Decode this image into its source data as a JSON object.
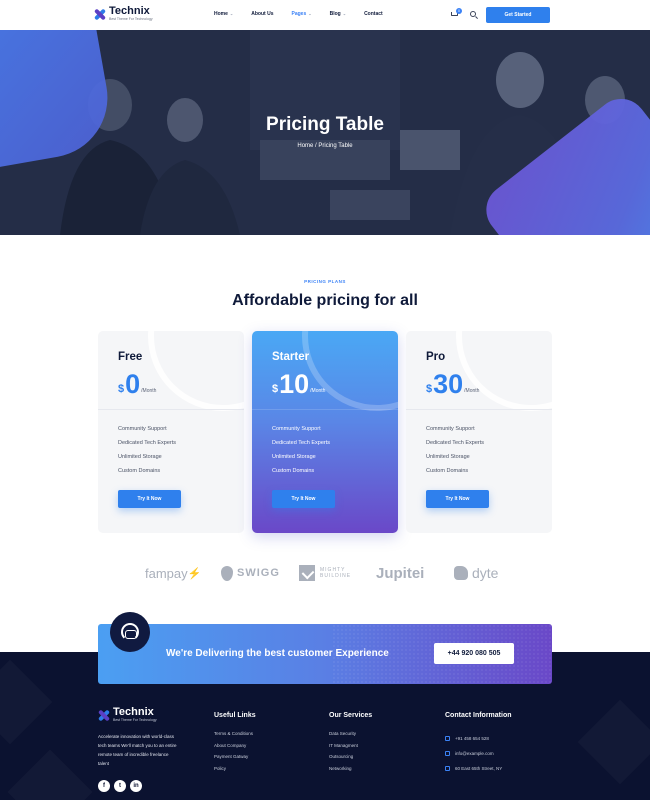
{
  "header": {
    "logo_name": "Technix",
    "logo_tagline": "Best Theme For Technology",
    "nav": [
      {
        "label": "Home",
        "caret": true
      },
      {
        "label": "About Us",
        "caret": false
      },
      {
        "label": "Pages",
        "caret": true
      },
      {
        "label": "Blog",
        "caret": true
      },
      {
        "label": "Contact",
        "caret": false
      }
    ],
    "cart_count": "0",
    "cta_label": "Get Started"
  },
  "hero": {
    "title": "Pricing Table",
    "breadcrumb": "Home / Pricing Table"
  },
  "pricing": {
    "eyebrow": "PRICING PLANS",
    "title": "Affordable pricing for all",
    "plans": [
      {
        "name": "Free",
        "currency": "$",
        "price": "0",
        "period": "/Month",
        "features": [
          "Community Support",
          "Dedicated Tech Experts",
          "Unlimited Storage",
          "Custom Domains"
        ],
        "button": "Try It Now"
      },
      {
        "name": "Starter",
        "currency": "$",
        "price": "10",
        "period": "/Month",
        "features": [
          "Community Support",
          "Dedicated Tech Experts",
          "Unlimited Storage",
          "Custom Domains"
        ],
        "button": "Try It Now"
      },
      {
        "name": "Pro",
        "currency": "$",
        "price": "30",
        "period": "/Month",
        "features": [
          "Community Support",
          "Dedicated Tech Experts",
          "Unlimited Storage",
          "Custom Domains"
        ],
        "button": "Try It Now"
      }
    ]
  },
  "brands": {
    "fampay": "fampay",
    "swiggy": "SWIGG",
    "mighty_1": "MIGHTY",
    "mighty_2": "BUILDINE",
    "jupiter": "Jupitei",
    "dyte": "dyte"
  },
  "banner": {
    "text": "We're Delivering the best customer Experience",
    "phone": "+44 920 080 505"
  },
  "footer": {
    "logo_name": "Technix",
    "logo_tagline": "Best Theme For Technology",
    "about": "Accelerate innovation with world-class tech teams We'll match you to an entire remote team of incredible freelance talent",
    "socials": [
      "f",
      "t",
      "in"
    ],
    "useful_links": {
      "title": "Useful Links",
      "items": [
        "Terms & Conditions",
        "About Company",
        "Payment Gatway",
        "Policy"
      ]
    },
    "services": {
      "title": "Our Services",
      "items": [
        "Data Security",
        "IT Managment",
        "Outsourcing",
        "Networking"
      ]
    },
    "contact": {
      "title": "Contact Information",
      "items": [
        "+91 458 654 528",
        "info@example.com",
        "60 East 65th Street, NY"
      ]
    }
  },
  "colors": {
    "accent": "#2f80ed",
    "dark": "#0b1230",
    "heading": "#0f1a3a"
  }
}
